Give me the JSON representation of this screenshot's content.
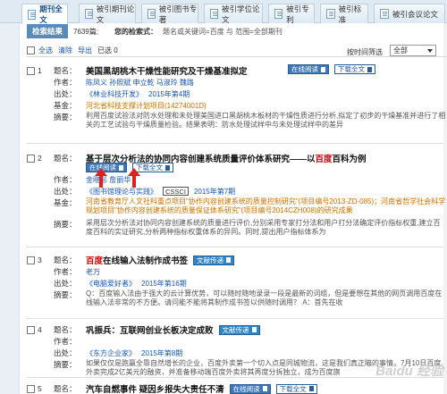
{
  "tabs": [
    {
      "label": "期刊全文",
      "active": true
    },
    {
      "label": "被引期刊论文",
      "active": false
    },
    {
      "label": "被引图书专著",
      "active": false
    },
    {
      "label": "被引学位论文",
      "active": false
    },
    {
      "label": "被引专利",
      "active": false
    },
    {
      "label": "被引标准",
      "active": false
    },
    {
      "label": "被引会议论文",
      "active": false
    }
  ],
  "results": {
    "title": "检索结果",
    "count": "7639篇;",
    "condition_label": "您的检索式：",
    "condition": "题名或关键词=百度 与 范围=全部期刊"
  },
  "toolbar": {
    "select_all": "全选",
    "clear": "清除",
    "export": "导出",
    "selected": "已选 0"
  },
  "sort": {
    "label": "按时间筛选",
    "value": "全部"
  },
  "records": [
    {
      "num": "1",
      "title_pre": "美国黑胡桃木干燥性能研究及干燥基准拟定",
      "title_hl": "",
      "title_post": "",
      "author_label": "作者：",
      "authors": "陈凤义 孙照斌 申立乾 马淑玲 魏路",
      "source_label": "出处：",
      "journal": "《林业科技开发》",
      "year": "2015年第4期",
      "fund_label": "基金：",
      "fund": "河北省科技支撑计划项目(14274001D)",
      "abstract_label": "摘要：",
      "abstract": "利用百度试验法对防水处理和未处理美国进口黑胡桃木板材的干燥性质进行分析,拟定了初步的干燥基准并进行了相关的工艺试验与干燥质量检验。结果表明：防水处理试样中与未处理试样中的差异",
      "buttons": {
        "read": "在线阅读",
        "download": "下载全文"
      }
    },
    {
      "num": "2",
      "title_pre": "基于层次分析法的协同内容创建系统质量评价体系研究——以",
      "title_hl": "百度",
      "title_post": "百科为例",
      "author_label": "作者：",
      "authors": "金晓彤 詹丽华",
      "source_label": "出处：",
      "journal": "《图书馆理论与实践》",
      "cssci": "CSSCI",
      "year": "2015年第7期",
      "fund_label": "基金：",
      "fund": "河南省教育厅人文社科重点项目\"协作内容创建系统的质量控制研究\"(项目编号2013-ZD-085)；河南省哲学社会科学规划项目\"协作内容创建系统的质量保证体系研究\"(项目编号2014CZH008)的研究成果",
      "abstract_label": "摘要：",
      "abstract": "采用层次分析法对协同内容创建系统的质量进行评价,分别采用专家打分法和用户打分法确定评价指标权重,建立百度百科的实证研究,分析两种指标权重体系的异同。同时,提出用户指标体系为",
      "buttons": {
        "read": "在线阅读",
        "download": "下载全文"
      }
    },
    {
      "num": "3",
      "title_pre": "",
      "title_hl": "百度",
      "title_post": "在线输入法制作成书签",
      "author_label": "作者：",
      "authors": "老万",
      "source_label": "出处：",
      "journal": "《电脑爱好者》",
      "year": "2015年第16期",
      "abstract_label": "摘要：",
      "abstract": "Q：百度输入法由于强大的云计算优势，可以随时随地录录一段是最新的词组，但是要想在其他的网页调用百度在线输入法非常的不方便。请问能不能将其制作成书签以供随时调用？ A：首先在收",
      "buttons": {
        "doc": "文献传递"
      }
    },
    {
      "num": "4",
      "title_pre": "巩振兵：互联网创业长板决定成败",
      "title_hl": "",
      "title_post": "",
      "author_label": "作者：",
      "authors": "",
      "source_label": "出处：",
      "journal": "《东方企业家》",
      "year": "2015年第8期",
      "abstract_label": "摘要：",
      "abstract": "如果仅仅是跑赢全靠自然增长的企业，百度外卖第一个切入点是同城物流，这是我们真正瞄的事情。7月10日百度外卖完成2亿美元的融资，并准备移动端百度外卖将其再度分拆独立，成为百度旗",
      "buttons": {
        "doc": "文献传递"
      }
    },
    {
      "num": "5",
      "title_pre": "汽车自燃事件 疑因乡报失大责任不清",
      "title_hl": "",
      "title_post": "",
      "buttons": {
        "read": "在线阅读",
        "download": "下载全文"
      }
    }
  ],
  "watermark": "Baidu 经验"
}
